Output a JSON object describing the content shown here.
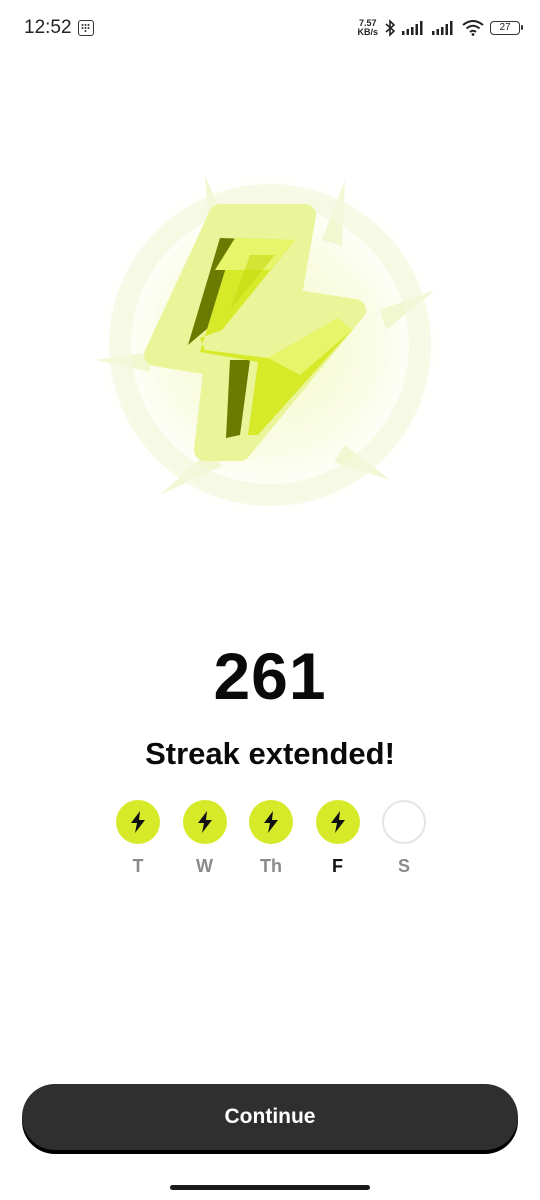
{
  "status_bar": {
    "time": "12:52",
    "net_speed_value": "7.57",
    "net_speed_unit": "KB/s",
    "battery": "27",
    "icons": [
      "grid-notification-icon",
      "bluetooth-icon",
      "signal-icon",
      "signal-icon",
      "wifi-icon",
      "battery-icon"
    ]
  },
  "hero": {
    "icon": "lightning-bolt-icon",
    "colors": {
      "bolt_light": "#e6f56a",
      "bolt_main": "#d7ea2a",
      "bolt_dark": "#6b7a00",
      "glow": "#eff7b0"
    }
  },
  "streak": {
    "count": "261",
    "title": "Streak extended!"
  },
  "week": [
    {
      "label": "T",
      "completed": true,
      "current": false
    },
    {
      "label": "W",
      "completed": true,
      "current": false
    },
    {
      "label": "Th",
      "completed": true,
      "current": false
    },
    {
      "label": "F",
      "completed": true,
      "current": true
    },
    {
      "label": "S",
      "completed": false,
      "current": false
    }
  ],
  "actions": {
    "continue_label": "Continue"
  },
  "colors": {
    "accent": "#d7ea2a",
    "button_bg": "#2f2f2f",
    "button_text": "#ffffff"
  }
}
